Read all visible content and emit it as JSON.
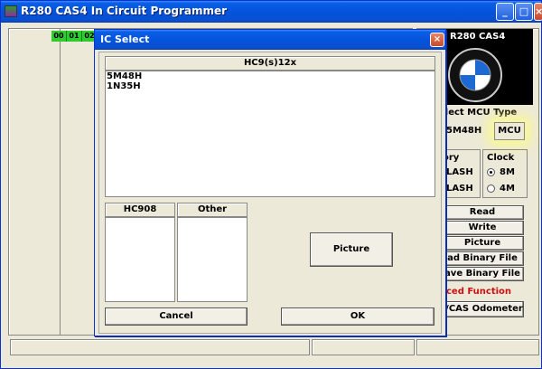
{
  "main": {
    "title": "R280 CAS4 In Circuit Programmer",
    "minimize": "_",
    "maximize": "□",
    "close": "×",
    "hex_cells": [
      "00",
      "01",
      "02"
    ]
  },
  "right": {
    "brand": "R280 CAS4",
    "logo_letters": "B M W",
    "mcu_type_label": "elect MCU Type",
    "mcu_value": "5M48H",
    "mcu_button": "MCU",
    "memory_label": "ory",
    "flash1": "LASH",
    "flash2": "LASH",
    "clock_label": "Clock",
    "clock_8m": "8M",
    "clock_4m": "4M",
    "clock_selected": "8M",
    "buttons": {
      "read": "Read",
      "write": "Write",
      "picture": "Picture",
      "load": "ad Binary File",
      "save": "ave Binary File"
    },
    "advanced_label": "ced Function",
    "advanced_color": "#d01010",
    "odometer": "/CAS Odometer"
  },
  "dialog": {
    "title": "IC Select",
    "close": "×",
    "hc9_header": "HC9(s)12x",
    "hc9_items": [
      "5M48H",
      "1N35H"
    ],
    "hc908_header": "HC908",
    "other_header": "Other",
    "picture_button": "Picture",
    "cancel_button": "Cancel",
    "ok_button": "OK"
  }
}
